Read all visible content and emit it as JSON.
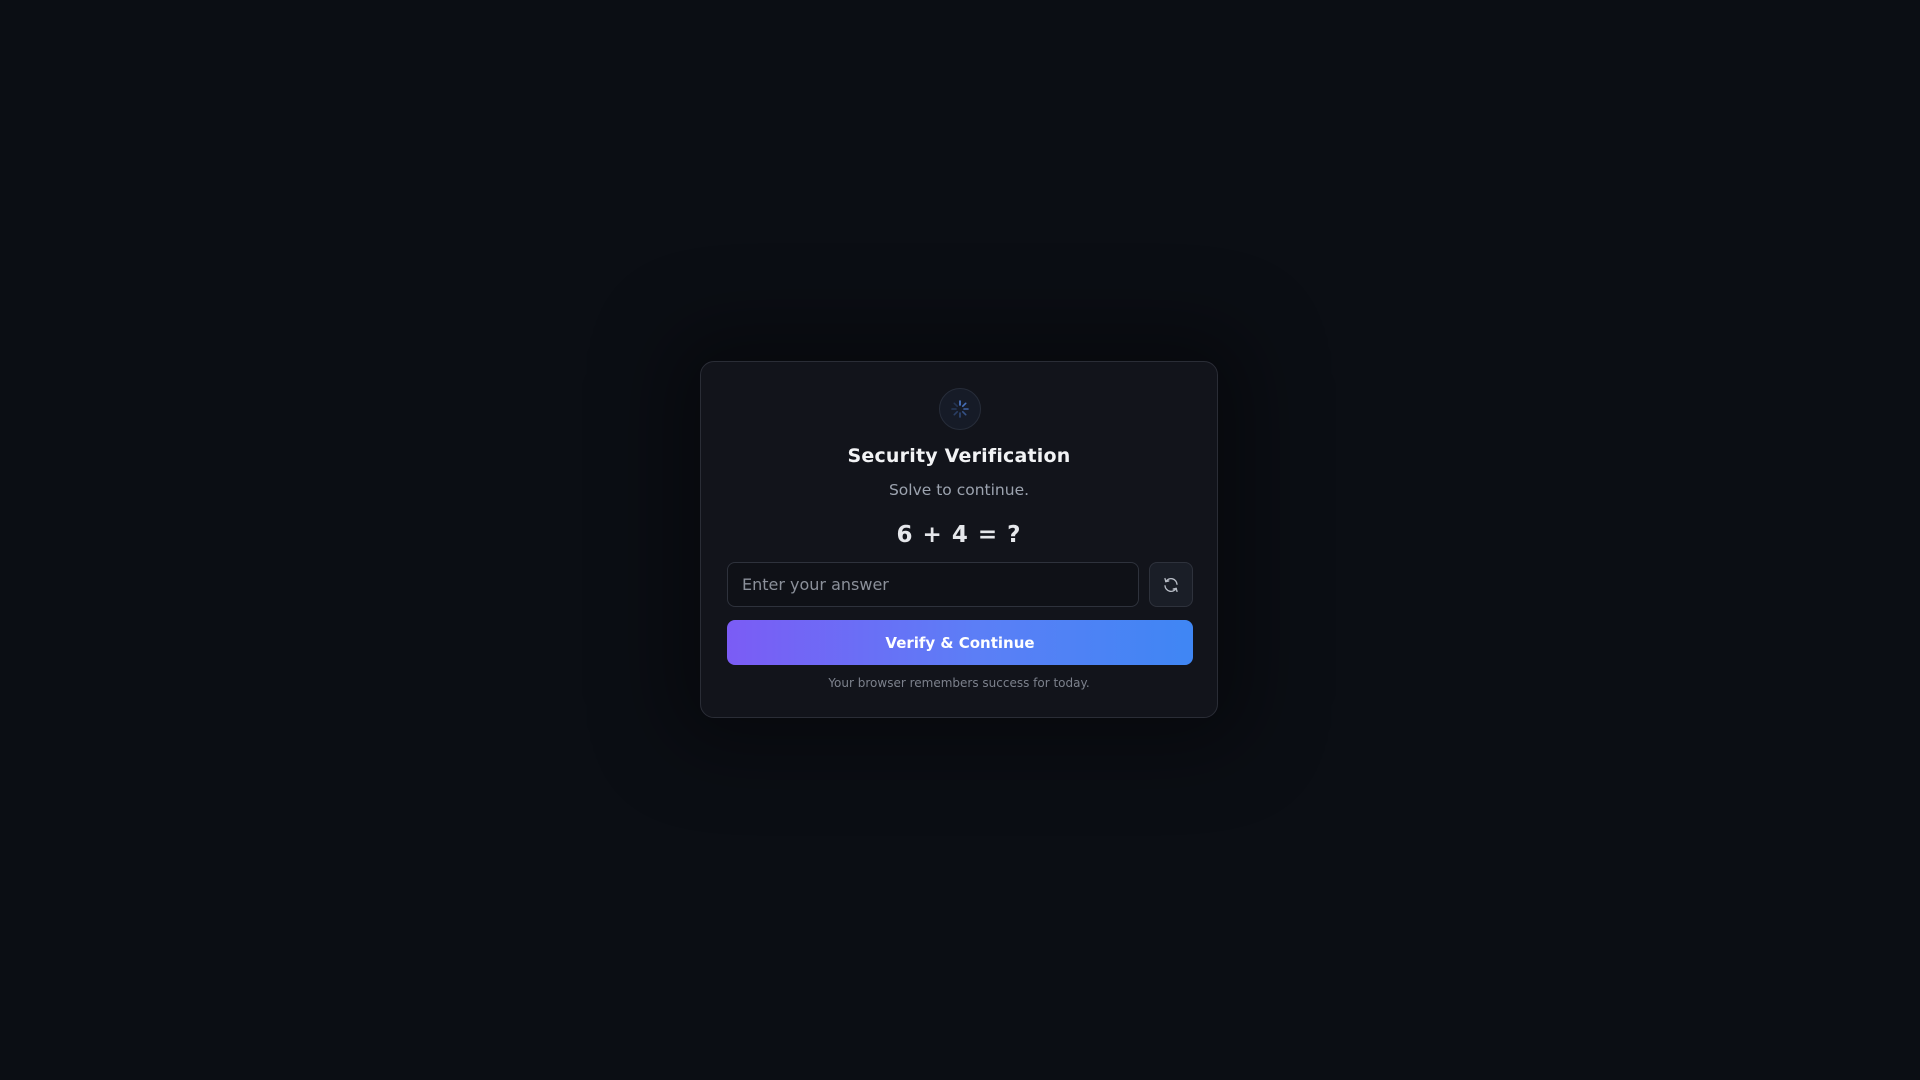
{
  "captcha": {
    "title": "Security Verification",
    "subtitle": "Solve to continue.",
    "equation": "6 + 4 = ?",
    "input": {
      "placeholder": "Enter your answer",
      "value": ""
    },
    "refresh_icon": "refresh-icon",
    "status_icon": "spinner-icon",
    "verify_label": "Verify & Continue",
    "footnote": "Your browser remembers success for today."
  },
  "colors": {
    "background": "#0b0e14",
    "card": "#12141b",
    "gradient_start": "#7b5cf5",
    "gradient_end": "#3f86f4",
    "spinner": "#4f7fd6"
  }
}
